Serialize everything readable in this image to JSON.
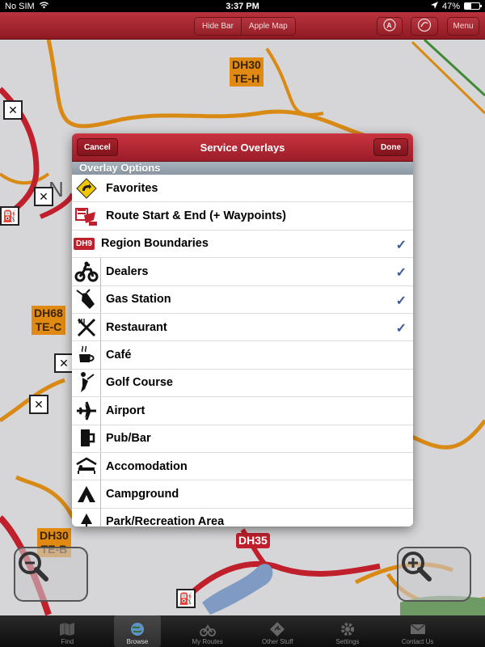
{
  "status_bar": {
    "carrier": "No SIM",
    "time": "3:37 PM",
    "battery_percent": "47%",
    "battery_level": 0.47
  },
  "toolbar": {
    "hide_bar_label": "Hide Bar",
    "apple_map_label": "Apple Map",
    "menu_label": "Menu"
  },
  "map": {
    "route_labels": {
      "dh30_top": "DH30\nTE-H",
      "dh68": "DH68\nTE-C",
      "dh30_bottom": "DH30\nTE-B",
      "dh35": "DH35"
    },
    "partial_text": "N"
  },
  "modal": {
    "cancel_label": "Cancel",
    "title": "Service Overlays",
    "done_label": "Done",
    "section_header": "Overlay Options",
    "items": [
      {
        "label": "Favorites",
        "icon": "favorites-icon",
        "checked": false
      },
      {
        "label": "Route Start & End (+ Waypoints)",
        "icon": "route-start-end-icon",
        "checked": false
      },
      {
        "label": "Region Boundaries",
        "icon": "region-boundaries-icon",
        "checked": true
      },
      {
        "label": "Dealers",
        "icon": "dealers-icon",
        "checked": true
      },
      {
        "label": "Gas Station",
        "icon": "gas-station-icon",
        "checked": true
      },
      {
        "label": "Restaurant",
        "icon": "restaurant-icon",
        "checked": true
      },
      {
        "label": "Café",
        "icon": "cafe-icon",
        "checked": false
      },
      {
        "label": "Golf Course",
        "icon": "golf-course-icon",
        "checked": false
      },
      {
        "label": "Airport",
        "icon": "airport-icon",
        "checked": false
      },
      {
        "label": "Pub/Bar",
        "icon": "pub-bar-icon",
        "checked": false
      },
      {
        "label": "Accomodation",
        "icon": "accommodation-icon",
        "checked": false
      },
      {
        "label": "Campground",
        "icon": "campground-icon",
        "checked": false
      },
      {
        "label": "Park/Recreation Area",
        "icon": "park-recreation-icon",
        "checked": false
      }
    ],
    "check_glyph": "✓",
    "region_badge": "DH9"
  },
  "tab_bar": {
    "tabs": [
      {
        "label": "Find",
        "icon": "find-icon",
        "active": false
      },
      {
        "label": "Browse",
        "icon": "browse-icon",
        "active": true
      },
      {
        "label": "My Routes",
        "icon": "my-routes-icon",
        "active": false
      },
      {
        "label": "Other Stuff",
        "icon": "other-stuff-icon",
        "active": false
      },
      {
        "label": "Settings",
        "icon": "settings-icon",
        "active": false
      },
      {
        "label": "Contact Us",
        "icon": "contact-us-icon",
        "active": false
      }
    ]
  },
  "colors": {
    "toolbar_red": "#a5252f",
    "route_red": "#c0202c",
    "route_orange": "#e08a14",
    "checkmark_blue": "#3b5b9a",
    "section_header": "#98a4ae"
  }
}
